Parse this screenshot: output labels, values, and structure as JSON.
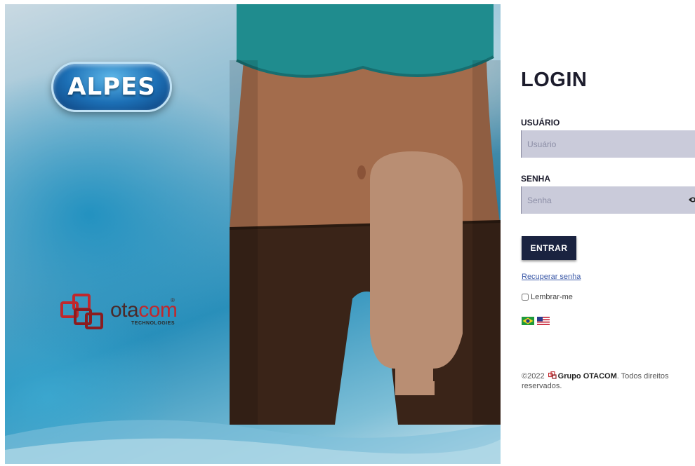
{
  "hero": {
    "brand_logo_text": "ALPES",
    "partner_logo": {
      "name_prefix": "ota",
      "name_suffix": "com",
      "subtitle": "TECHNOLOGIES",
      "registered_mark": "®"
    }
  },
  "login": {
    "title": "LOGIN",
    "username": {
      "label": "USUÁRIO",
      "placeholder": "Usuário",
      "value": ""
    },
    "password": {
      "label": "SENHA",
      "placeholder": "Senha",
      "value": ""
    },
    "submit_label": "ENTRAR",
    "recover_link": "Recuperar senha",
    "remember_label": "Lembrar-me",
    "remember_checked": false,
    "languages": [
      {
        "name": "brazil-flag",
        "code": "pt-BR"
      },
      {
        "name": "usa-flag",
        "code": "en-US"
      }
    ]
  },
  "footer": {
    "prefix": "©2022",
    "company": "Grupo OTACOM",
    "suffix": ". Todos direitos reservados."
  },
  "colors": {
    "button_bg": "#1a2340",
    "field_bg": "#cacbda",
    "link": "#3c5aa8",
    "brand_red": "#c0282d"
  }
}
